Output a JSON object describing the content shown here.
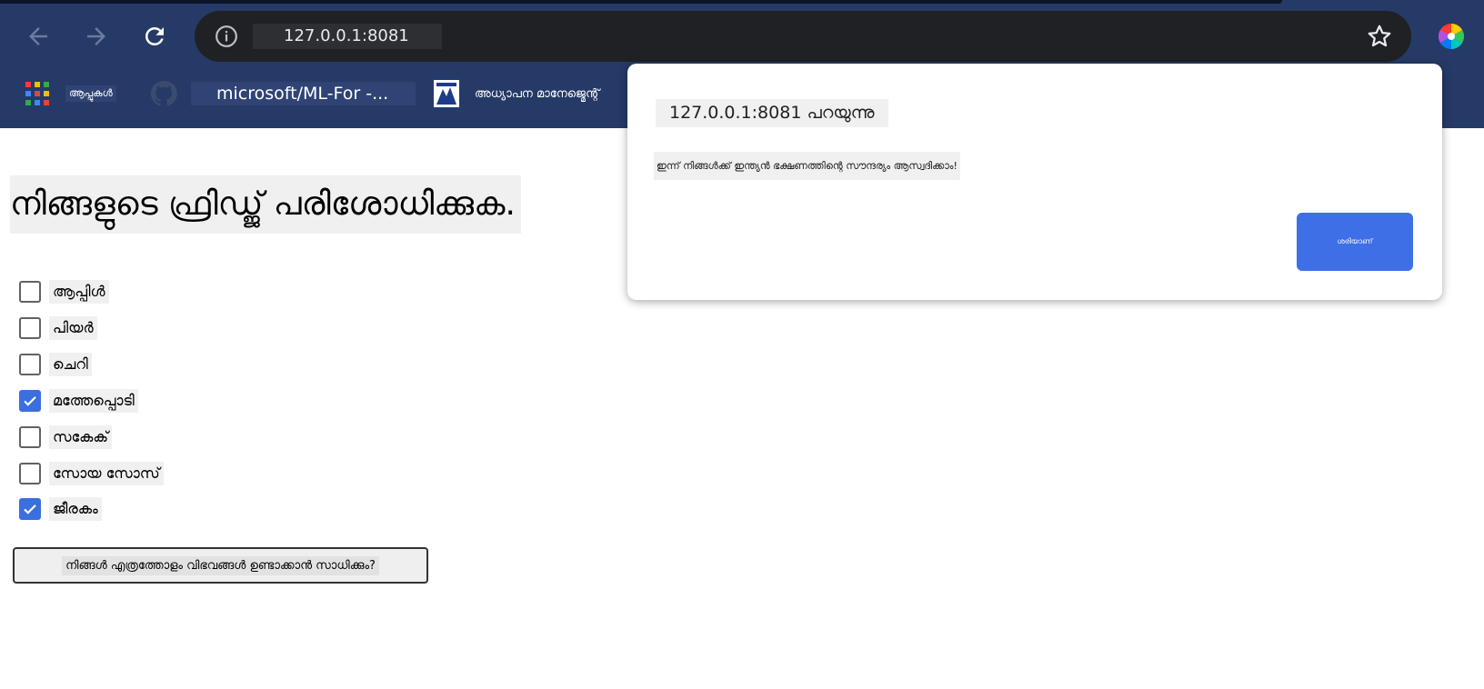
{
  "browser": {
    "url": "127.0.0.1:8081",
    "bookmarks": [
      {
        "label": "ആപ്പുകൾ",
        "icon": "apps-grid-icon"
      },
      {
        "label": "microsoft/ML-For -...",
        "icon": "github-icon"
      },
      {
        "label": "അധ്യാപന മാനേജ്മെന്റ്",
        "icon": "edu-site-icon"
      }
    ]
  },
  "page": {
    "title": "നിങ്ങളുടെ ഫ്രിഡ്ജ് പരിശോധിക്കുക.",
    "ingredients": [
      {
        "label": "ആപ്പിൾ",
        "checked": false
      },
      {
        "label": "പിയർ",
        "checked": false
      },
      {
        "label": "ചെറി",
        "checked": false
      },
      {
        "label": "മത്തേപ്പൊടി",
        "checked": true
      },
      {
        "label": "സകേക്",
        "checked": false
      },
      {
        "label": "സോയ സോസ്",
        "checked": false
      },
      {
        "label": "ജീരകം",
        "checked": true
      }
    ],
    "submit_label": "നിങ്ങൾ എത്രത്തോളം വിഭവങ്ങൾ ഉണ്ടാക്കാൻ സാധിക്കും?"
  },
  "dialog": {
    "title": "127.0.0.1:8081 പറയുന്നു",
    "message": "ഇന്ന് നിങ്ങൾക്ക് ഇന്ത്യൻ ഭക്ഷണത്തിന്റെ സൗന്ദര്യം ആസ്വദിക്കാം!",
    "ok_label": "ശരിയാണ്"
  },
  "colors": {
    "chrome_bg": "#253a66",
    "omnibox_bg": "#202124",
    "accent_blue": "#3e6fe6"
  }
}
